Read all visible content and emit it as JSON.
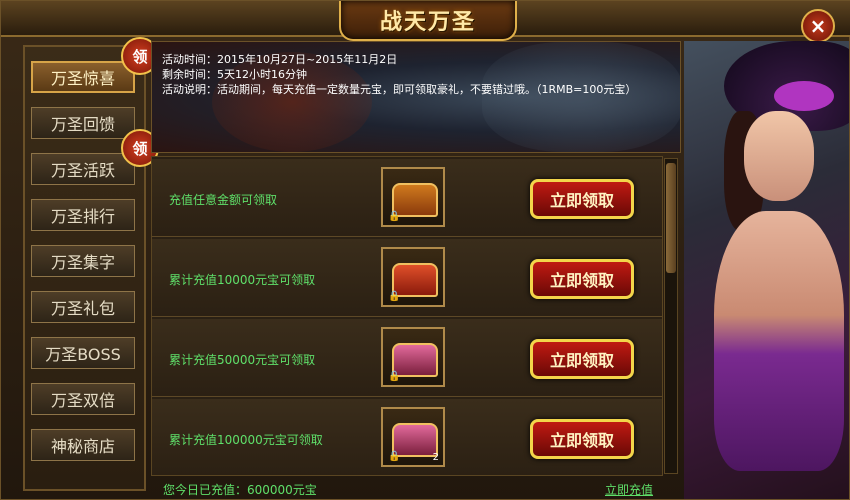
{
  "window": {
    "title": "战天万圣",
    "close_glyph": "×"
  },
  "sidebar": {
    "badge_text": "领",
    "items": [
      {
        "label": "万圣惊喜",
        "active": true,
        "badge": true
      },
      {
        "label": "万圣回馈",
        "active": false,
        "badge": false
      },
      {
        "label": "万圣活跃",
        "active": false,
        "badge": true
      },
      {
        "label": "万圣排行",
        "active": false,
        "badge": false
      },
      {
        "label": "万圣集字",
        "active": false,
        "badge": false
      },
      {
        "label": "万圣礼包",
        "active": false,
        "badge": false
      },
      {
        "label": "万圣BOSS",
        "active": false,
        "badge": false
      },
      {
        "label": "万圣双倍",
        "active": false,
        "badge": false
      },
      {
        "label": "神秘商店",
        "active": false,
        "badge": false
      }
    ]
  },
  "banner": {
    "time_label": "活动时间：",
    "time_value": "2015年10月27日~2015年11月2日",
    "remain_label": "剩余时间：",
    "remain_value": "5天12小时16分钟",
    "desc_label": "活动说明：",
    "desc_value": "活动期间，每天充值一定数量元宝，即可领取豪礼，不要错过哦。（1RMB=100元宝）"
  },
  "rewards": [
    {
      "condition": "充值任意金额可领取",
      "button": "立即领取",
      "chest": "gold-chest-icon",
      "count": ""
    },
    {
      "condition": "累计充值10000元宝可领取",
      "button": "立即领取",
      "chest": "red-chest-icon",
      "count": ""
    },
    {
      "condition": "累计充值50000元宝可领取",
      "button": "立即领取",
      "chest": "pink-chest-icon",
      "count": ""
    },
    {
      "condition": "累计充值100000元宝可领取",
      "button": "立即领取",
      "chest": "pink-chest-icon",
      "count": "2"
    }
  ],
  "footer": {
    "today_recharge": "您今日已充值：600000元宝",
    "recharge_link": "立即充值"
  },
  "colors": {
    "accent_gold": "#f3d54a",
    "claim_red": "#c01a12",
    "text_green": "#5fe06a"
  }
}
